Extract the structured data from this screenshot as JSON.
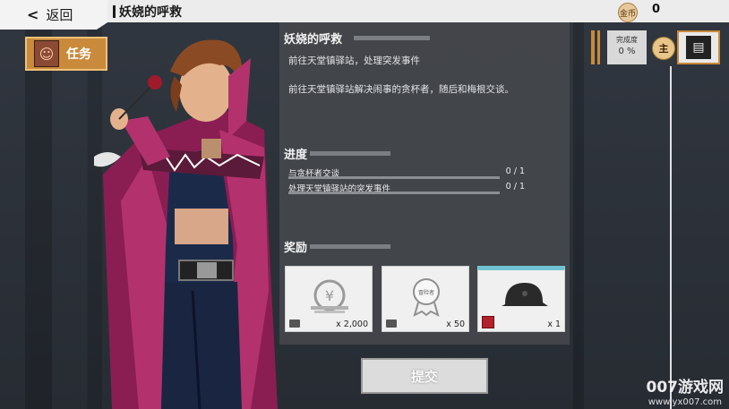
{
  "header": {
    "back_label": "返回",
    "quest_title": "妖娆的呼救",
    "coin_label": "金币",
    "coin_value": "0"
  },
  "task_tag": {
    "label": "任务"
  },
  "quest": {
    "title": "妖娆的呼救",
    "desc1": "前往天堂镇驿站，处理突发事件",
    "desc2": "前往天堂镇驿站解决闹事的贪杯者，随后和梅根交谈。"
  },
  "progress": {
    "title": "进度",
    "items": [
      {
        "label": "与贪杯者交谈",
        "count": "0 / 1"
      },
      {
        "label": "处理天堂镇驿站的突发事件",
        "count": "0 / 1"
      }
    ]
  },
  "rewards": {
    "title": "奖励",
    "items": [
      {
        "qty": "x 2,000",
        "icon": "coin-stack-icon"
      },
      {
        "qty": "x 50",
        "icon": "medal-icon",
        "medal_text": "冒险者"
      },
      {
        "qty": "x 1",
        "icon": "helmet-icon"
      }
    ]
  },
  "submit_label": "提交",
  "completion": {
    "label": "完成度",
    "value": "0 %"
  },
  "main_badge": "主",
  "watermark": {
    "brand": "007游戏网",
    "url": "www.yx007.com"
  },
  "colors": {
    "accent": "#c98a3c",
    "panel": "#46484c",
    "rare": "#6fc3d0"
  }
}
